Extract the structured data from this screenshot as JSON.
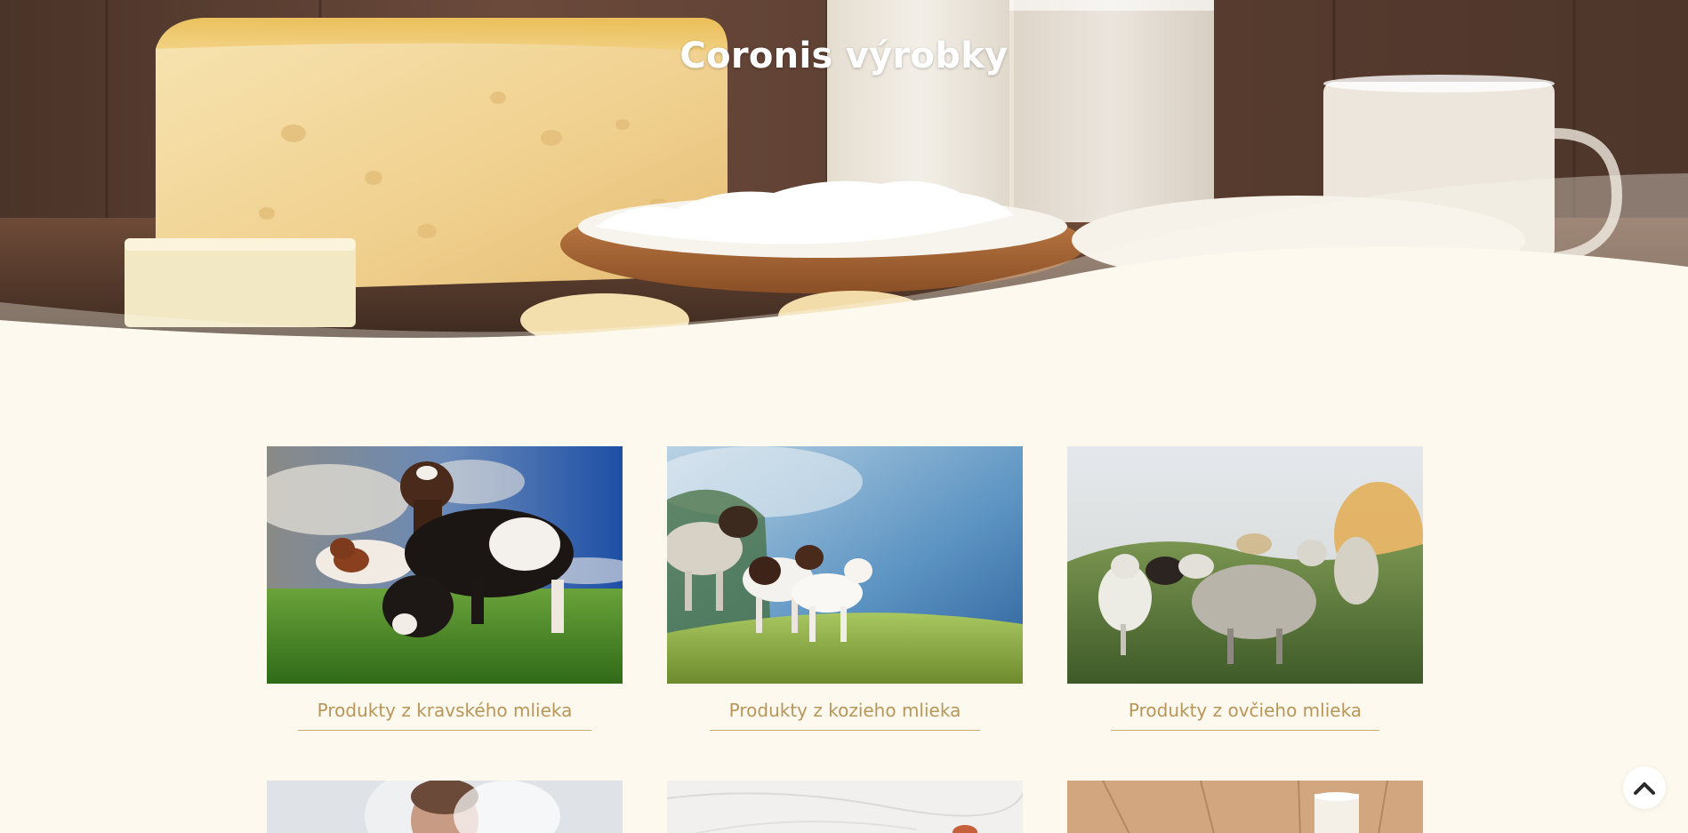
{
  "hero": {
    "title": "Coronis výrobky"
  },
  "products": [
    {
      "label": "Produkty z kravského mlieka",
      "image_icon": "cows-photo"
    },
    {
      "label": "Produkty z kozieho mlieka",
      "image_icon": "goats-photo"
    },
    {
      "label": "Produkty z ovčieho mlieka",
      "image_icon": "sheep-photo"
    }
  ],
  "second_row": [
    {
      "image_icon": "person-photo"
    },
    {
      "image_icon": "marble-photo"
    },
    {
      "image_icon": "milk-glass-photo"
    }
  ],
  "colors": {
    "background": "#fdf9ee",
    "caption": "#b8965a",
    "caption_line": "#c9ab72",
    "title": "#ffffff"
  },
  "scroll_top": {
    "icon": "chevron-up-icon"
  }
}
